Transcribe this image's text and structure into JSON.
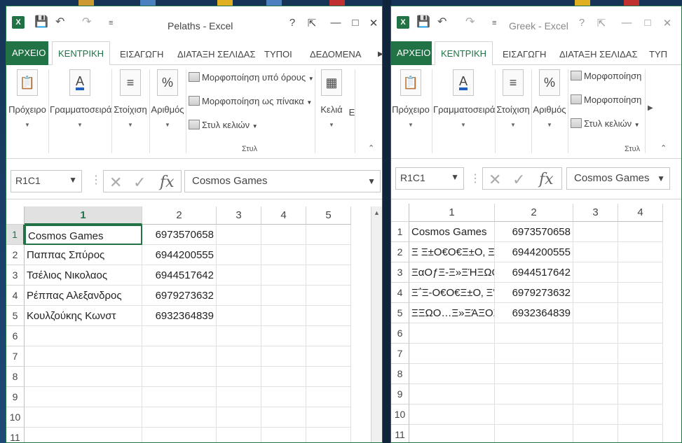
{
  "win1": {
    "title": "Pelaths - Excel",
    "tabs": [
      "ΑΡΧΕΙΟ",
      "ΚΕΝΤΡΙΚΗ",
      "ΕΙΣΑΓΩΓΗ",
      "ΔΙΑΤΑΞΗ ΣΕΛΙΔΑΣ",
      "ΤΥΠΟΙ",
      "ΔΕΔΟΜΕΝΑ"
    ],
    "groups": {
      "clipboard": "Πρόχειρο",
      "font": "Γραμματοσειρά",
      "alignment": "Στοίχιση",
      "number": "Αριθμός",
      "cells": "Κελιά",
      "editing": "Ε"
    },
    "styles": {
      "conditional": "Μορφοποίηση υπό όρους",
      "table": "Μορφοποίηση ως πίνακα",
      "cellstyles": "Στυλ κελιών",
      "label": "Στυλ"
    },
    "namebox": "R1C1",
    "formula": "Cosmos Games",
    "cols": [
      "1",
      "2",
      "3",
      "4",
      "5"
    ],
    "rows": [
      "1",
      "2",
      "3",
      "4",
      "5",
      "6",
      "7",
      "8",
      "9",
      "10",
      "11"
    ],
    "data": [
      [
        "Cosmos Games",
        "6973570658"
      ],
      [
        "Παππας Σπύρος",
        "6944200555"
      ],
      [
        "Τσέλιος Νικολαος",
        "6944517642"
      ],
      [
        "Ρέππας Αλεξανδρος",
        "6979273632"
      ],
      [
        "Κουλζούκης Κωνστ",
        "6932364839"
      ]
    ]
  },
  "win2": {
    "title": "Greek - Excel",
    "tabs": [
      "ΑΡΧΕΙΟ",
      "ΚΕΝΤΡΙΚΗ",
      "ΕΙΣΑΓΩΓΗ",
      "ΔΙΑΤΑΞΗ ΣΕΛΙΔΑΣ",
      "ΤΥΠ"
    ],
    "groups": {
      "clipboard": "Πρόχειρο",
      "font": "Γραμματοσειρά",
      "alignment": "Στοίχιση",
      "number": "Αριθμός"
    },
    "styles": {
      "conditional": "Μορφοποίηση υ",
      "table": "Μορφοποίηση ω",
      "cellstyles": "Στυλ κελιών",
      "label": "Στυλ"
    },
    "namebox": "R1C1",
    "formula": "Cosmos Games",
    "cols": [
      "1",
      "2",
      "3",
      "4"
    ],
    "rows": [
      "1",
      "2",
      "3",
      "4",
      "5",
      "6",
      "7",
      "8",
      "9",
      "10",
      "11"
    ],
    "data": [
      [
        "Cosmos Games",
        "6973570658"
      ],
      [
        "Ξ Ξ±Ο€Ο€Ξ±Ο‚ Ξ£Ο€",
        "6944200555"
      ],
      [
        "ΞαΟƒΞ-Ξ»ΞΉΞΩΟ‚ Ξ",
        "6944517642"
      ],
      [
        "Ξ΅Ξ-Ο€Ο€Ξ±Ο‚ Ξ'Ξ»",
        "6979273632"
      ],
      [
        "ΞΞΩΟ…Ξ»ΞΆΞΟΞΞ",
        "6932364839"
      ]
    ]
  },
  "icons": {
    "paste": "clipboard-icon",
    "font": "font-color-icon",
    "align": "align-icon",
    "percent": "percent-icon",
    "cells": "cells-icon"
  }
}
